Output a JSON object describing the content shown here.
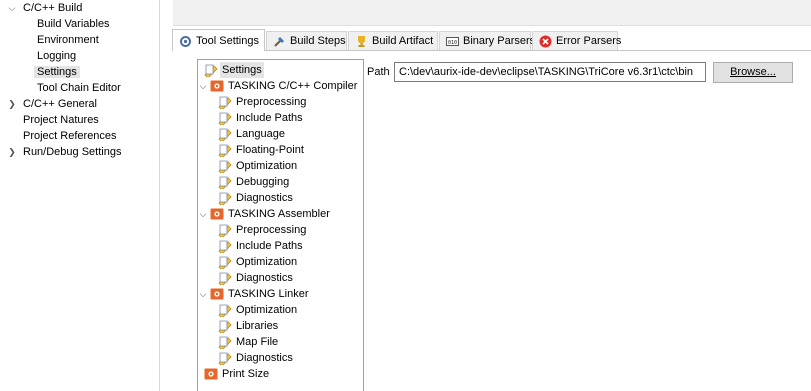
{
  "left_nav": {
    "items": [
      {
        "label": "C/C++ Build",
        "expanded": true
      },
      {
        "label": "Build Variables"
      },
      {
        "label": "Environment"
      },
      {
        "label": "Logging"
      },
      {
        "label": "Settings",
        "selected": true
      },
      {
        "label": "Tool Chain Editor"
      },
      {
        "label": "C/C++ General",
        "expanded": false
      },
      {
        "label": "Project Natures"
      },
      {
        "label": "Project References"
      },
      {
        "label": "Run/Debug Settings",
        "expanded": false
      }
    ]
  },
  "tabs": [
    {
      "label": "Tool Settings",
      "icon": "gear-tool-icon",
      "active": true
    },
    {
      "label": "Build Steps",
      "icon": "build-steps-icon"
    },
    {
      "label": "Build Artifact",
      "icon": "trophy-icon"
    },
    {
      "label": "Binary Parsers",
      "icon": "binary-icon"
    },
    {
      "label": "Error Parsers",
      "icon": "error-icon"
    }
  ],
  "tree": {
    "settings": "Settings",
    "compiler": {
      "label": "TASKING C/C++ Compiler",
      "children": [
        "Preprocessing",
        "Include Paths",
        "Language",
        "Floating-Point",
        "Optimization",
        "Debugging",
        "Diagnostics"
      ]
    },
    "assembler": {
      "label": "TASKING Assembler",
      "children": [
        "Preprocessing",
        "Include Paths",
        "Optimization",
        "Diagnostics"
      ]
    },
    "linker": {
      "label": "TASKING Linker",
      "children": [
        "Optimization",
        "Libraries",
        "Map File",
        "Diagnostics"
      ]
    },
    "print_size": "Print Size"
  },
  "path": {
    "label": "Path",
    "value": "C:\\dev\\aurix-ide-dev\\eclipse\\TASKING\\TriCore v6.3r1\\ctc\\bin"
  },
  "browse_label": "Browse...",
  "colors": {
    "tool_icon": "#e8662a",
    "page_icon": "#f2c14e",
    "error_icon": "#d9302f",
    "selection": "#e4e4e4"
  }
}
